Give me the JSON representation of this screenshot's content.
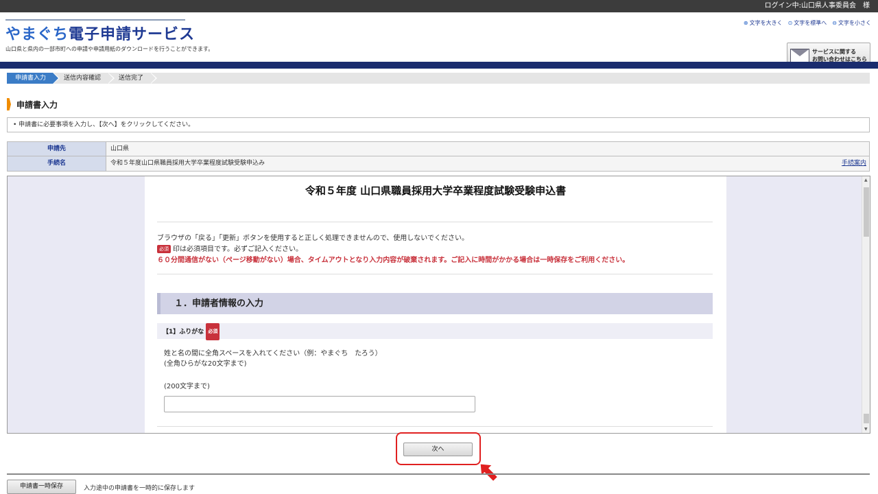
{
  "topbar": {
    "login": "ログイン中:山口県人事委員会　様"
  },
  "header": {
    "logo_part1": "やまぐち",
    "logo_part2": "電子申請サービス",
    "tagline": "山口県と県内の一部市町への申請や申請用紙のダウンロードを行うことができます。",
    "font_large": "文字を大きく",
    "font_normal": "文字を標準へ",
    "font_small": "文字を小さく",
    "contact_line1": "サービスに関する",
    "contact_line2": "お問い合わせはこちら"
  },
  "steps": [
    {
      "label": "申請書入力",
      "active": true
    },
    {
      "label": "送信内容確認",
      "active": false
    },
    {
      "label": "送信完了",
      "active": false
    }
  ],
  "section_title": "申請書入力",
  "instruction": "• 申請書に必要事項を入力し、【次へ】をクリックしてください。",
  "info": {
    "dest_label": "申請先",
    "dest_value": "山口県",
    "proc_label": "手続名",
    "proc_value": "令和５年度山口県職員採用大学卒業程度試験受験申込み",
    "guide_link": "手続案内"
  },
  "form": {
    "title": "令和５年度 山口県職員採用大学卒業程度試験受験申込書",
    "notice1": "ブラウザの「戻る」「更新」ボタンを使用すると正しく処理できませんので、使用しないでください。",
    "required_badge": "必須",
    "notice2": "印は必須項目です。必ずご記入ください。",
    "notice3": "６０分間通信がない（ページ移動がない）場合、タイムアウトとなり入力内容が破棄されます。ご記入に時間がかかる場合は一時保存をご利用ください。",
    "section1": "１．申請者情報の入力",
    "field1_label": "【1】ふりがな",
    "field1_note1": "姓と名の間に全角スペースを入れてください（例：やまぐち　たろう）",
    "field1_note2": "(全角ひらがな20文字まで)",
    "field1_limit": "(200文字まで)",
    "field1_value": ""
  },
  "buttons": {
    "next": "次へ",
    "temp_save": "申請書一時保存",
    "temp_save_note": "入力途中の申請書を一時的に保存します"
  },
  "colors": {
    "accent": "#1a2c6e",
    "required": "#c8313b",
    "highlight": "#e02020"
  }
}
